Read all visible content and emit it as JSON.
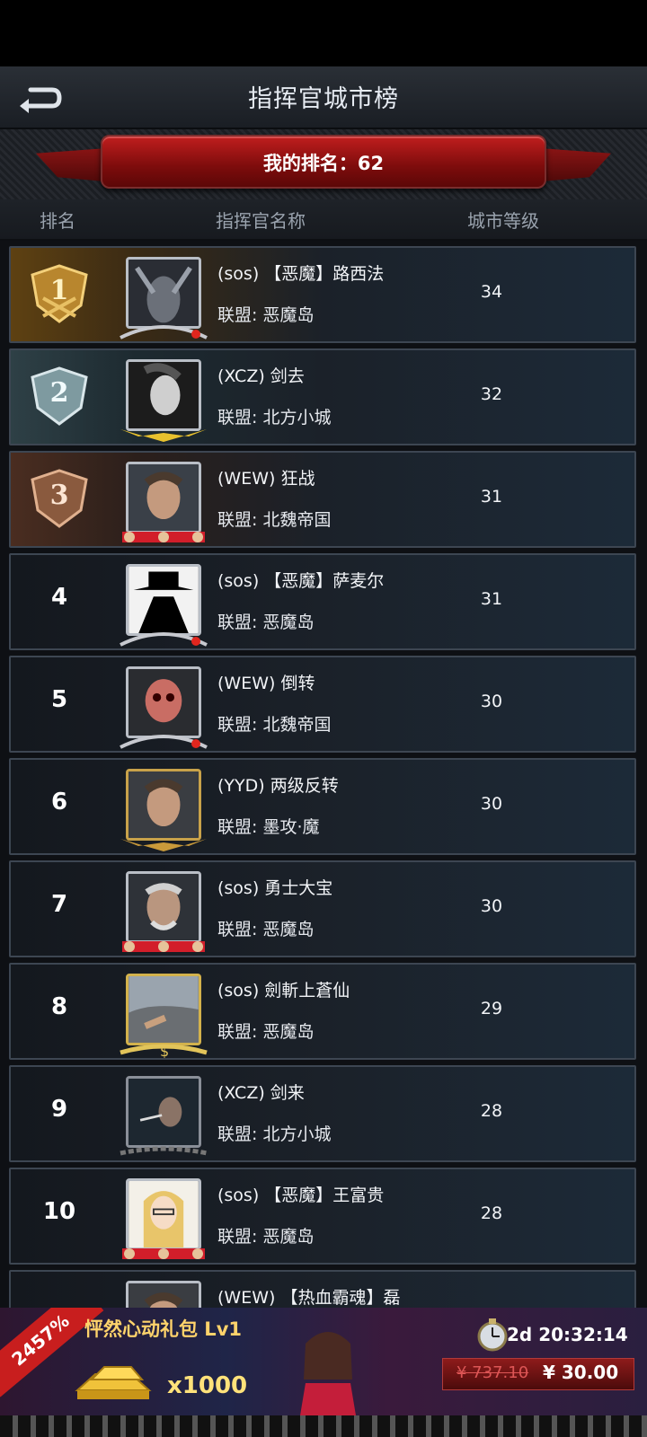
{
  "header": {
    "title": "指挥官城市榜"
  },
  "my_rank": {
    "label": "我的排名：62"
  },
  "columns": {
    "rank": "排名",
    "name": "指挥官名称",
    "level": "城市等级"
  },
  "rows": [
    {
      "rank": "1",
      "name": "(sos) 【恶魔】路西法",
      "alliance": "联盟: 恶魔岛",
      "level": "34"
    },
    {
      "rank": "2",
      "name": "(XCZ) 剑去",
      "alliance": "联盟: 北方小城",
      "level": "32"
    },
    {
      "rank": "3",
      "name": "(WEW) 狂战",
      "alliance": "联盟: 北魏帝国",
      "level": "31"
    },
    {
      "rank": "4",
      "name": "(sos) 【恶魔】萨麦尔",
      "alliance": "联盟: 恶魔岛",
      "level": "31"
    },
    {
      "rank": "5",
      "name": "(WEW) 倒转",
      "alliance": "联盟: 北魏帝国",
      "level": "30"
    },
    {
      "rank": "6",
      "name": "(YYD) 两级反转",
      "alliance": "联盟: 墨攻·魔",
      "level": "30"
    },
    {
      "rank": "7",
      "name": "(sos) 勇士大宝",
      "alliance": "联盟: 恶魔岛",
      "level": "30"
    },
    {
      "rank": "8",
      "name": "(sos) 劍斬上蒼仙",
      "alliance": "联盟: 恶魔岛",
      "level": "29"
    },
    {
      "rank": "9",
      "name": "(XCZ) 剑来",
      "alliance": "联盟: 北方小城",
      "level": "28"
    },
    {
      "rank": "10",
      "name": "(sos) 【恶魔】王富贵",
      "alliance": "联盟: 恶魔岛",
      "level": "28"
    },
    {
      "rank": "",
      "name": "(WEW) 【热血霸魂】磊",
      "alliance": "",
      "level": ""
    }
  ],
  "ad": {
    "percent": "2457%",
    "title": "怦然心动礼包 Lv1",
    "quantity": "x1000",
    "timer": "2d 20:32:14",
    "old_price": "¥ 737.10",
    "new_price": "¥ 30.00"
  }
}
